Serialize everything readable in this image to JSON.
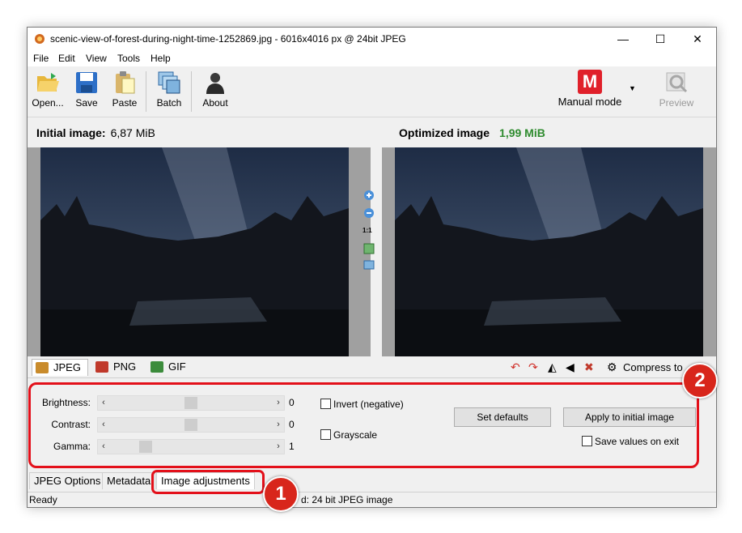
{
  "window": {
    "title": "scenic-view-of-forest-during-night-time-1252869.jpg - 6016x4016 px @ 24bit JPEG",
    "minimize": "—",
    "maximize": "☐",
    "close": "✕"
  },
  "menu": [
    "File",
    "Edit",
    "View",
    "Tools",
    "Help"
  ],
  "toolbar": {
    "open": "Open...",
    "save": "Save",
    "paste": "Paste",
    "batch": "Batch",
    "about": "About",
    "mode_letter": "M",
    "mode_label": "Manual mode",
    "preview": "Preview"
  },
  "initial": {
    "label": "Initial image:",
    "size": "6,87 MiB"
  },
  "optimized": {
    "label": "Optimized image",
    "size": "1,99 MiB",
    "size_color": "#2e8b2e"
  },
  "zoom": {
    "one_to_one": "1:1"
  },
  "formats": [
    "JPEG",
    "PNG",
    "GIF"
  ],
  "compress": "Compress to",
  "adjust": {
    "brightness": {
      "label": "Brightness:",
      "value": "0",
      "level": 0.5
    },
    "contrast": {
      "label": "Contrast:",
      "value": "0",
      "level": 0.5
    },
    "gamma": {
      "label": "Gamma:",
      "value": "1",
      "level": 0.2
    },
    "invert": "Invert (negative)",
    "grayscale": "Grayscale",
    "set_defaults": "Set defaults",
    "apply": "Apply to initial image",
    "save_values": "Save values on exit"
  },
  "bottom_tabs": [
    "JPEG Options",
    "Metadata",
    "Image adjustments"
  ],
  "status": {
    "left": "Ready",
    "right": "d: 24 bit JPEG image"
  },
  "annotations": {
    "badge1": "1",
    "badge2": "2",
    "highlight_color": "#e3101a"
  }
}
